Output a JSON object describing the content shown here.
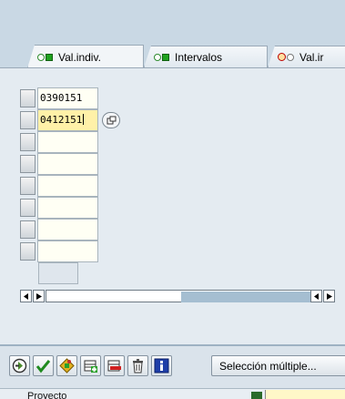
{
  "tabs": [
    {
      "label": "Val.indiv.",
      "active": true
    },
    {
      "label": "Intervalos",
      "active": false
    },
    {
      "label": "Val.ir",
      "active": false
    }
  ],
  "table": {
    "rows": [
      "0390151",
      "0412151",
      "",
      "",
      "",
      "",
      "",
      "",
      ""
    ]
  },
  "toolbar": {
    "multi_select_label": "Selección múltiple..."
  },
  "footer": {
    "field_label": "Proyecto"
  },
  "colors": {
    "active_cell": "#fff1a8",
    "green_status": "#1fa31f",
    "scroll_thumb": "#a5bed1"
  },
  "icons": [
    "execute-icon",
    "check-icon",
    "options-icon",
    "insert-row-icon",
    "delete-row-icon",
    "trash-icon",
    "info-icon",
    "multi-select-icon"
  ]
}
